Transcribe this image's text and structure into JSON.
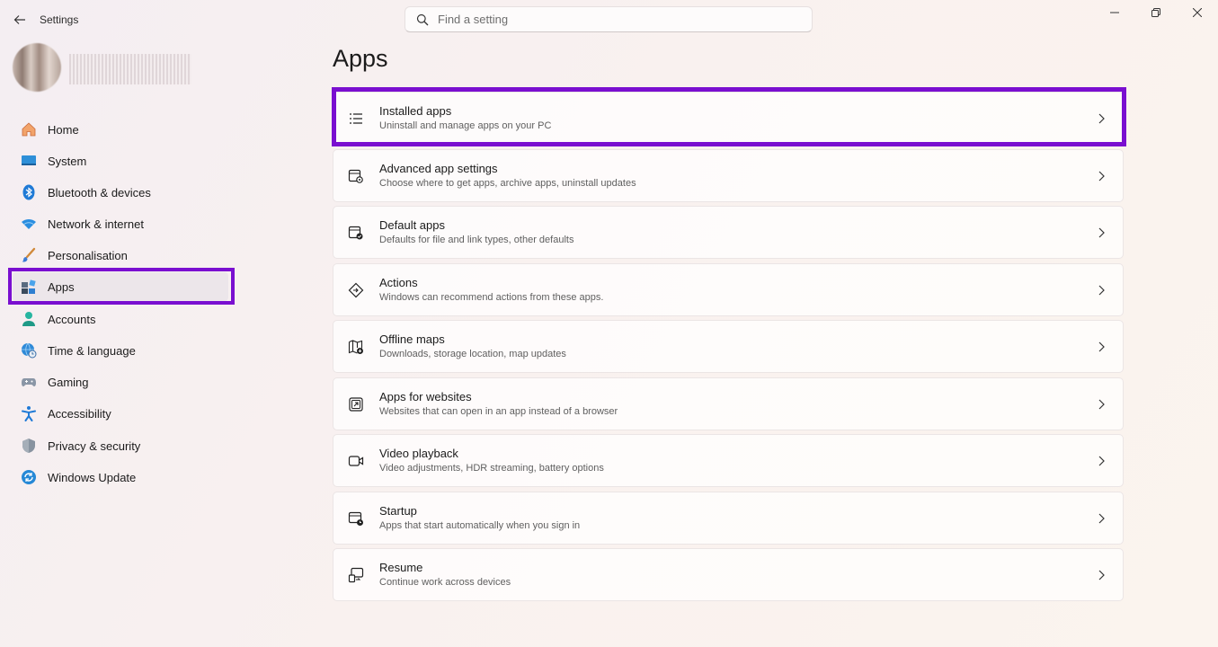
{
  "window": {
    "title": "Settings",
    "search_placeholder": "Find a setting"
  },
  "sidebar": {
    "items": [
      {
        "label": "Home",
        "icon": "home-icon"
      },
      {
        "label": "System",
        "icon": "system-icon"
      },
      {
        "label": "Bluetooth & devices",
        "icon": "bluetooth-icon"
      },
      {
        "label": "Network & internet",
        "icon": "wifi-icon"
      },
      {
        "label": "Personalisation",
        "icon": "brush-icon"
      },
      {
        "label": "Apps",
        "icon": "apps-icon",
        "selected": true
      },
      {
        "label": "Accounts",
        "icon": "person-icon"
      },
      {
        "label": "Time & language",
        "icon": "globe-clock-icon"
      },
      {
        "label": "Gaming",
        "icon": "gamepad-icon"
      },
      {
        "label": "Accessibility",
        "icon": "accessibility-icon"
      },
      {
        "label": "Privacy & security",
        "icon": "shield-icon"
      },
      {
        "label": "Windows Update",
        "icon": "update-icon"
      }
    ]
  },
  "main": {
    "title": "Apps",
    "cards": [
      {
        "title": "Installed apps",
        "desc": "Uninstall and manage apps on your PC",
        "icon": "list-icon"
      },
      {
        "title": "Advanced app settings",
        "desc": "Choose where to get apps, archive apps, uninstall updates",
        "icon": "app-settings-icon"
      },
      {
        "title": "Default apps",
        "desc": "Defaults for file and link types, other defaults",
        "icon": "default-apps-icon"
      },
      {
        "title": "Actions",
        "desc": "Windows can recommend actions from these apps.",
        "icon": "actions-icon"
      },
      {
        "title": "Offline maps",
        "desc": "Downloads, storage location, map updates",
        "icon": "map-icon"
      },
      {
        "title": "Apps for websites",
        "desc": "Websites that can open in an app instead of a browser",
        "icon": "open-external-icon"
      },
      {
        "title": "Video playback",
        "desc": "Video adjustments, HDR streaming, battery options",
        "icon": "video-icon"
      },
      {
        "title": "Startup",
        "desc": "Apps that start automatically when you sign in",
        "icon": "startup-icon"
      },
      {
        "title": "Resume",
        "desc": "Continue work across devices",
        "icon": "resume-icon"
      }
    ]
  },
  "colors": {
    "highlight": "#7a0fd0"
  }
}
